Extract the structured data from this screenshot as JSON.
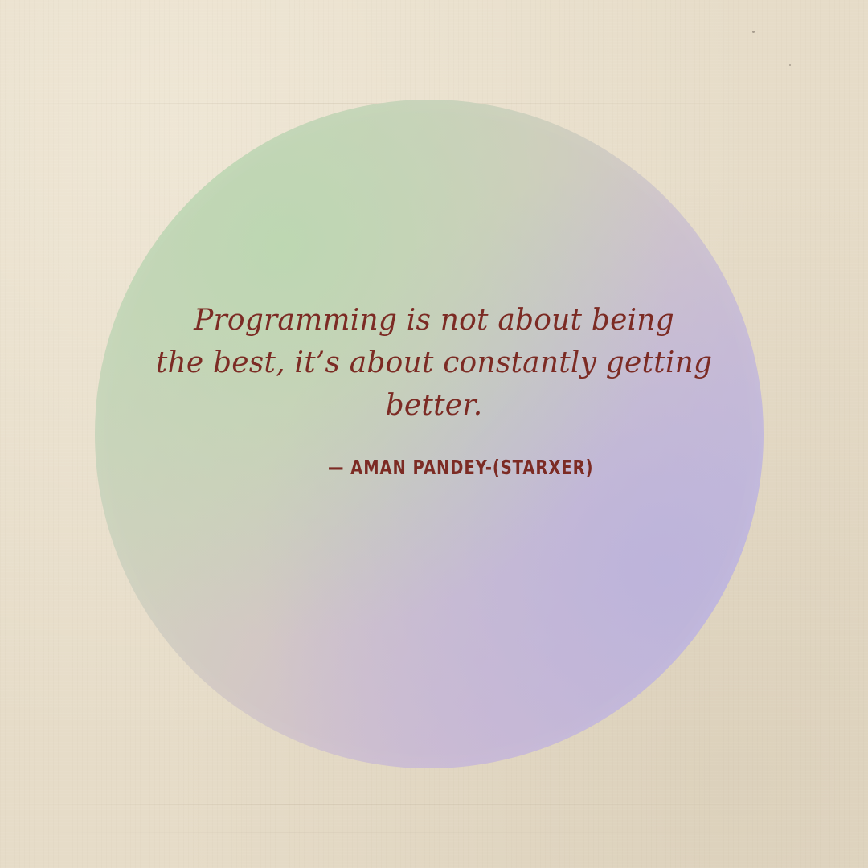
{
  "quote": {
    "lines": [
      "Programming is not about being",
      "the best, it’s about constantly getting",
      "better."
    ]
  },
  "author": {
    "text": "— AMAN PANDEY-(STARXER)"
  },
  "colors": {
    "background": "#e6dcc8",
    "text": "#7c2b24",
    "circle_green": "#c9d8bc",
    "circle_violet": "#c4bde0"
  }
}
